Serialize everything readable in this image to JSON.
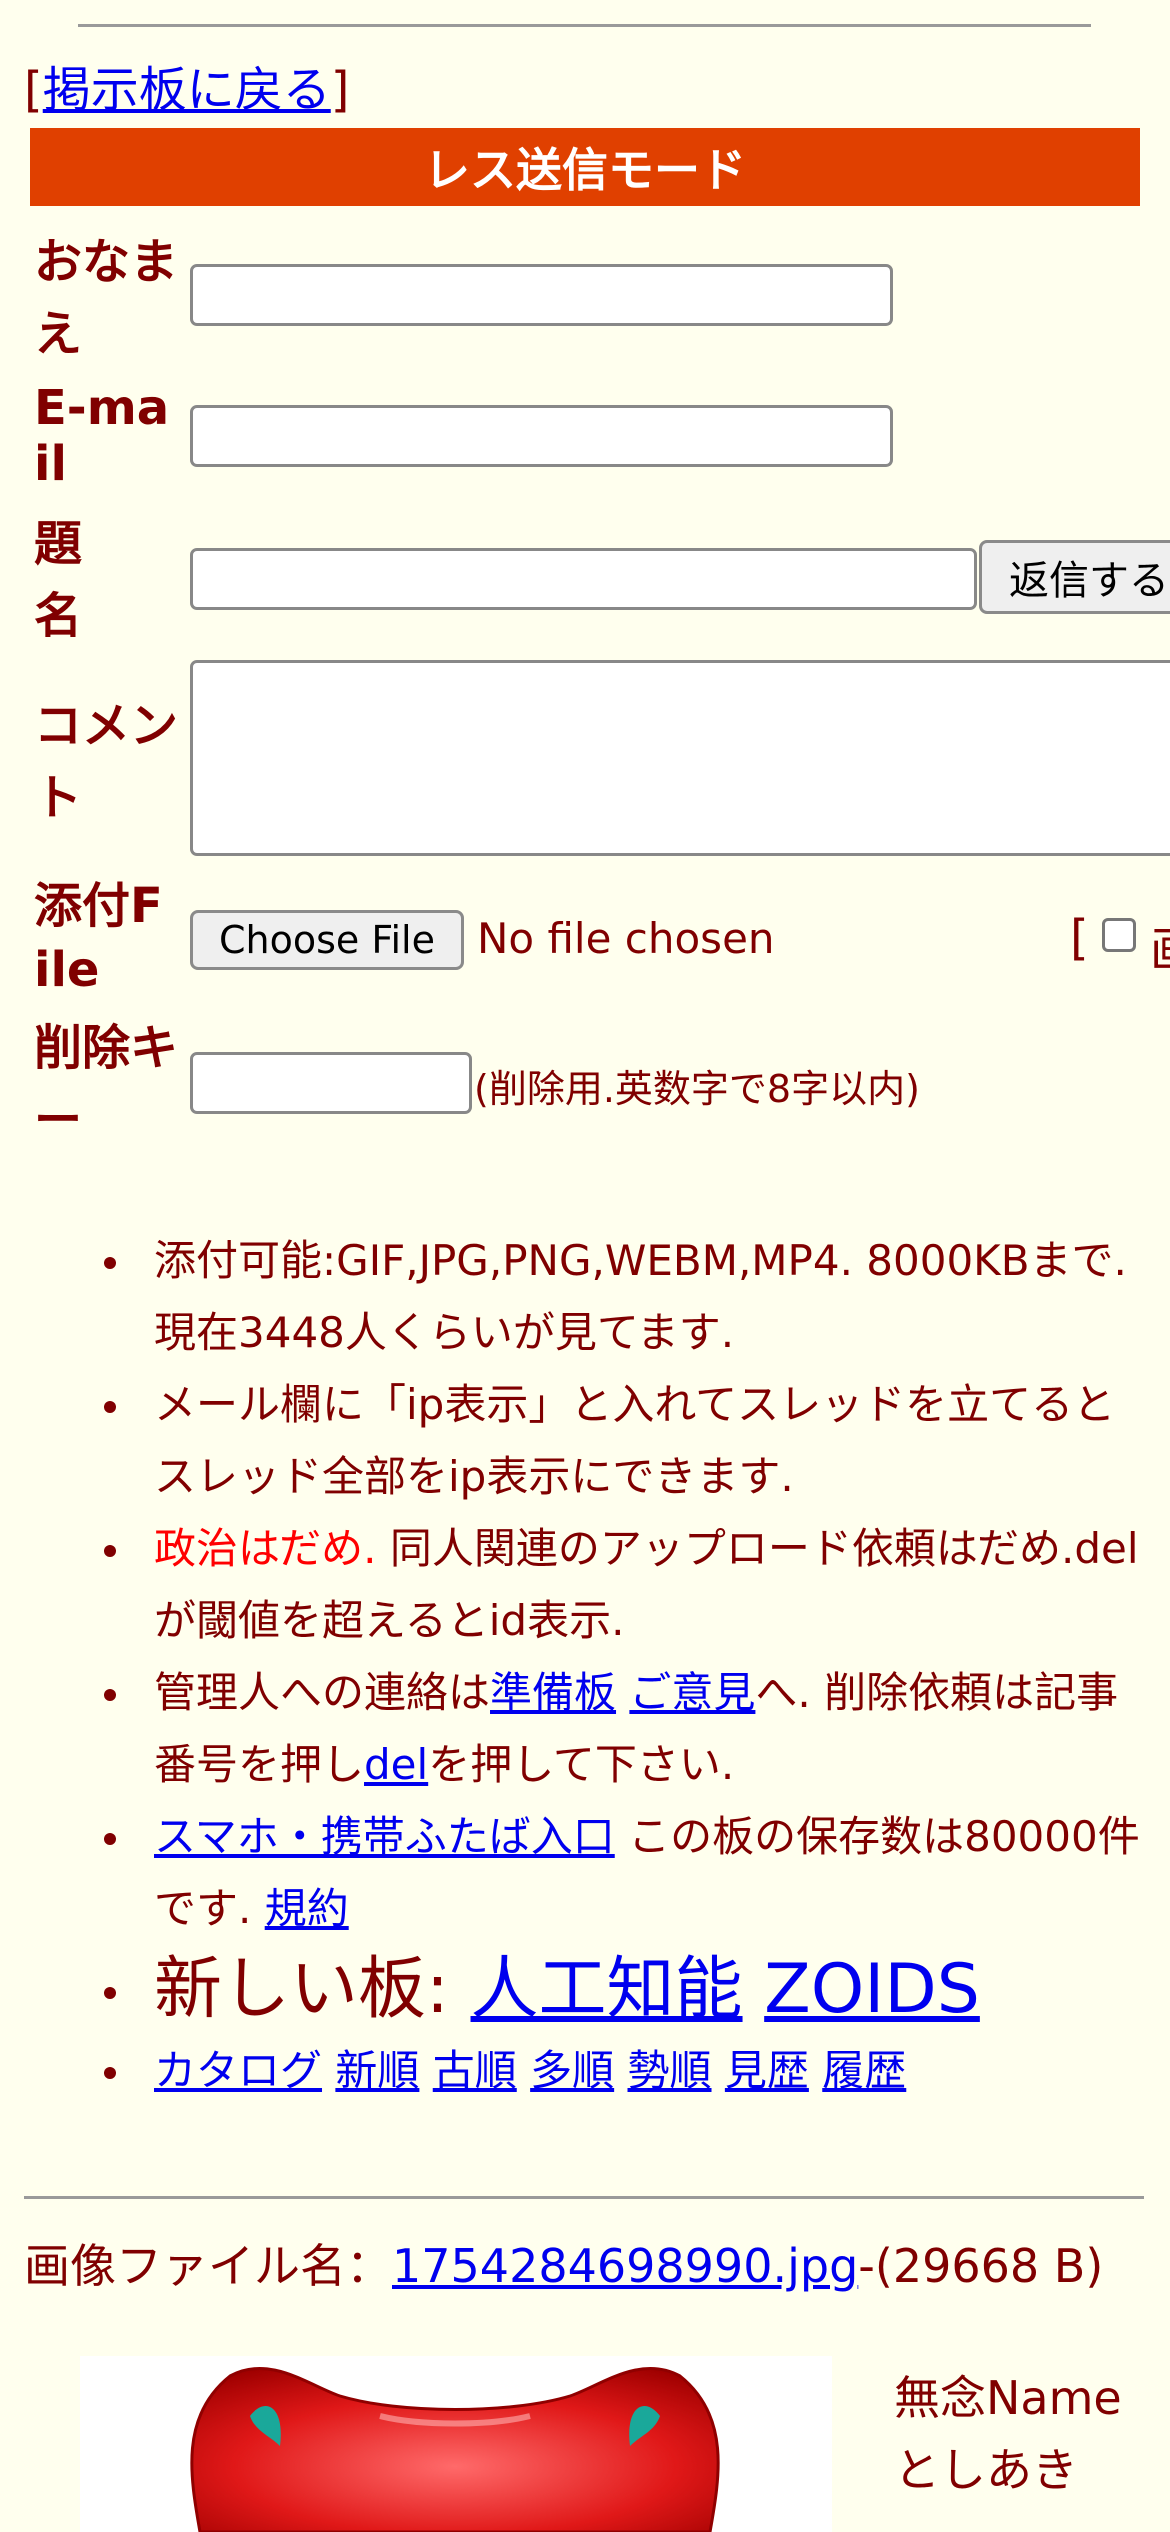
{
  "back_link": {
    "open": "[",
    "label": "掲示板に戻る",
    "close": "]"
  },
  "banner": "レス送信モード",
  "form": {
    "name_label": "おなまえ",
    "email_label": "E-mail",
    "subject_label": "題名",
    "comment_label": "コメント",
    "file_label": "添付File",
    "delkey_label": "削除キー",
    "submit_label": "返信する",
    "file_button_label": "Choose File",
    "file_status": "No file chosen",
    "image_option_prefix": "[",
    "image_option_partial": "画",
    "delkey_hint": "(削除用.英数字で8字以内)"
  },
  "notes": {
    "n1": "添付可能:GIF,JPG,PNG,WEBM,MP4. 8000KBまで. 現在3448人くらいが見てます.",
    "n2": "メール欄に「ip表示」と入れてスレッドを立てるとスレッド全部をip表示にできます.",
    "n3_red": "政治はだめ.",
    "n3_rest": " 同人関連のアップロード依頼はだめ.delが閾値を超えるとid表示.",
    "n4_a": "管理人への連絡は",
    "n4_link1": "準備板",
    "n4_sep": " ",
    "n4_link2": "ご意見",
    "n4_b": "へ. 削除依頼は記事番号を押し",
    "n4_link3": "del",
    "n4_c": "を押して下さい.",
    "n5_link1": "スマホ・携帯ふたば入口",
    "n5_mid": " この板の保存数は80000件です. ",
    "n5_link2": "規約",
    "n6_prefix": "新しい板: ",
    "n6_link1": "人工知能",
    "n6_link2": "ZOIDS",
    "nav": [
      "カタログ",
      "新順",
      "古順",
      "多順",
      "勢順",
      "見歴",
      "履歴"
    ]
  },
  "file_info": {
    "prefix": "画像ファイル名：",
    "filename": "1754284698990.jpg",
    "suffix": "-(29668 B)"
  },
  "poster": {
    "subject": "無念",
    "name": "Name",
    "author": "としあき"
  },
  "colors": {
    "banner": "#e04000",
    "text": "#800000",
    "link": "#0000ee",
    "background": "#ffffee",
    "warning": "#ff0000"
  },
  "icons": [
    "bullet-dot",
    "checkbox-unchecked",
    "image-thumbnail"
  ]
}
